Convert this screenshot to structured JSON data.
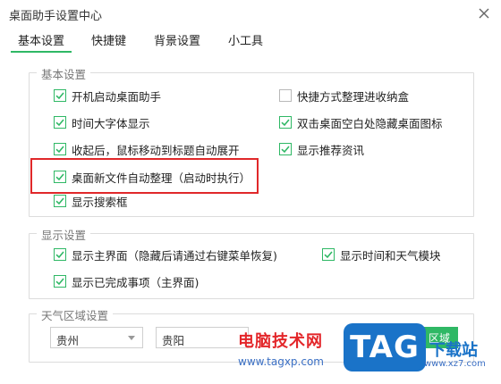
{
  "window": {
    "title": "桌面助手设置中心"
  },
  "tabs": [
    {
      "label": "基本设置",
      "active": true
    },
    {
      "label": "快捷键",
      "active": false
    },
    {
      "label": "背景设置",
      "active": false
    },
    {
      "label": "小工具",
      "active": false
    }
  ],
  "basic": {
    "title": "基本设置",
    "options": [
      {
        "label": "开机启动桌面助手",
        "checked": true
      },
      {
        "label": "时间大字体显示",
        "checked": true
      },
      {
        "label": "收起后，鼠标移动到标题自动展开",
        "checked": true
      },
      {
        "label": "桌面新文件自动整理（启动时执行）",
        "checked": true
      },
      {
        "label": "显示搜索框",
        "checked": true
      },
      {
        "label": "快捷方式整理进收纳盒",
        "checked": false
      },
      {
        "label": "双击桌面空白处隐藏桌面图标",
        "checked": true
      },
      {
        "label": "显示推荐资讯",
        "checked": true
      }
    ]
  },
  "display": {
    "title": "显示设置",
    "options": [
      {
        "label": "显示主界面（隐藏后请通过右键菜单恢复)",
        "checked": true
      },
      {
        "label": "显示已完成事项（主界面)",
        "checked": true
      },
      {
        "label": "显示时间和天气模块",
        "checked": true
      }
    ]
  },
  "weather": {
    "title": "天气区域设置",
    "province": "贵州",
    "city": "贵阳",
    "button": "区域"
  },
  "watermark": {
    "text": "电脑技术网",
    "url": "www.tagxp.com",
    "logo": "TAG",
    "site": "下载站",
    "url2": "www.xz7.com"
  },
  "colors": {
    "accent": "#2fb865",
    "highlight": "#e0282a"
  }
}
